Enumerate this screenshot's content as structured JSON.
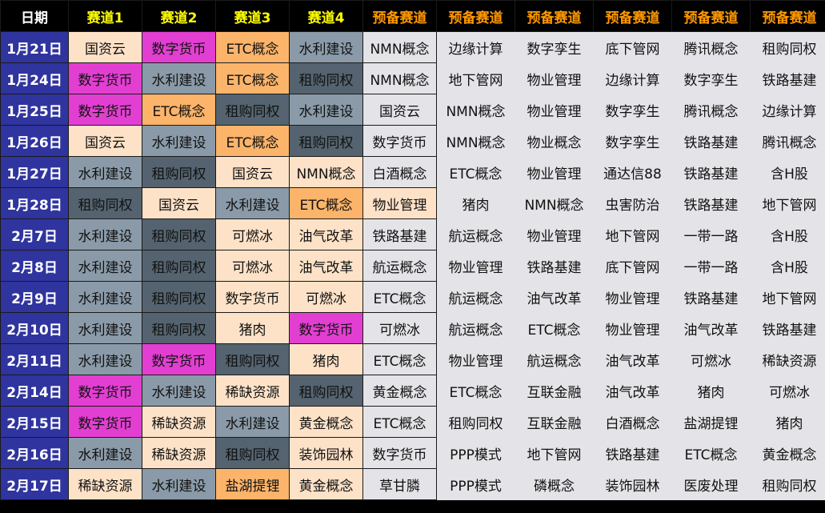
{
  "headers": [
    "日期",
    "赛道1",
    "赛道2",
    "赛道3",
    "赛道4",
    "预备赛道",
    "预备赛道",
    "预备赛道",
    "预备赛道",
    "预备赛道",
    "预备赛道"
  ],
  "rows": [
    {
      "date": "1月21日",
      "cells": [
        "国资云",
        "数字货币",
        "ETC概念",
        "水利建设",
        "NMN概念",
        "边缘计算",
        "数字孪生",
        "底下管网",
        "腾讯概念",
        "租购同权"
      ]
    },
    {
      "date": "1月24日",
      "cells": [
        "数字货币",
        "水利建设",
        "ETC概念",
        "租购同权",
        "NMN概念",
        "地下管网",
        "物业管理",
        "边缘计算",
        "数字孪生",
        "铁路基建"
      ]
    },
    {
      "date": "1月25日",
      "cells": [
        "数字货币",
        "ETC概念",
        "租购同权",
        "水利建设",
        "国资云",
        "NMN概念",
        "物业管理",
        "数字孪生",
        "腾讯概念",
        "边缘计算"
      ]
    },
    {
      "date": "1月26日",
      "cells": [
        "国资云",
        "水利建设",
        "ETC概念",
        "租购同权",
        "数字货币",
        "NMN概念",
        "物业概念",
        "数字孪生",
        "铁路基建",
        "腾讯概念"
      ]
    },
    {
      "date": "1月27日",
      "cells": [
        "水利建设",
        "租购同权",
        "国资云",
        "NMN概念",
        "白酒概念",
        "ETC概念",
        "物业管理",
        "通达信88",
        "铁路基建",
        "含H股"
      ]
    },
    {
      "date": "1月28日",
      "cells": [
        "租购同权",
        "国资云",
        "水利建设",
        "ETC概念",
        "物业管理",
        "猪肉",
        "NMN概念",
        "虫害防治",
        "铁路基建",
        "地下管网"
      ]
    },
    {
      "date": "2月7日",
      "cells": [
        "水利建设",
        "租购同权",
        "可燃冰",
        "油气改革",
        "铁路基建",
        "航运概念",
        "物业管理",
        "地下管网",
        "一带一路",
        "含H股"
      ]
    },
    {
      "date": "2月8日",
      "cells": [
        "水利建设",
        "租购同权",
        "可燃冰",
        "油气改革",
        "航运概念",
        "物业管理",
        "铁路基建",
        "底下管网",
        "一带一路",
        "含H股"
      ]
    },
    {
      "date": "2月9日",
      "cells": [
        "水利建设",
        "租购同权",
        "数字货币",
        "可燃冰",
        "ETC概念",
        "航运概念",
        "油气改革",
        "物业管理",
        "铁路基建",
        "地下管网"
      ]
    },
    {
      "date": "2月10日",
      "cells": [
        "水利建设",
        "租购同权",
        "猪肉",
        "数字货币",
        "可燃冰",
        "航运概念",
        "ETC概念",
        "物业管理",
        "油气改革",
        "铁路基建"
      ]
    },
    {
      "date": "2月11日",
      "cells": [
        "水利建设",
        "数字货币",
        "租购同权",
        "猪肉",
        "ETC概念",
        "物业管理",
        "航运概念",
        "油气改革",
        "可燃冰",
        "稀缺资源"
      ]
    },
    {
      "date": "2月14日",
      "cells": [
        "数字货币",
        "水利建设",
        "稀缺资源",
        "租购同权",
        "黄金概念",
        "ETC概念",
        "互联金融",
        "油气改革",
        "猪肉",
        "可燃冰"
      ]
    },
    {
      "date": "2月15日",
      "cells": [
        "数字货币",
        "稀缺资源",
        "水利建设",
        "黄金概念",
        "ETC概念",
        "租购同权",
        "互联金融",
        "白酒概念",
        "盐湖提锂",
        "猪肉"
      ]
    },
    {
      "date": "2月16日",
      "cells": [
        "水利建设",
        "稀缺资源",
        "租购同权",
        "装饰园林",
        "数字货币",
        "PPP模式",
        "地下管网",
        "铁路基建",
        "ETC概念",
        "黄金概念"
      ]
    },
    {
      "date": "2月17日",
      "cells": [
        "稀缺资源",
        "水利建设",
        "盐湖提锂",
        "黄金概念",
        "草甘膦",
        "PPP模式",
        "磷概念",
        "装饰园林",
        "医废处理",
        "租购同权"
      ]
    }
  ],
  "colors": {
    "header_bg": "#000000",
    "date_bg": "#2f349e",
    "track_header": "#ffff00",
    "reserve_header": "#ff9900",
    "peach": "#fde2c8",
    "magenta": "#e23fd2",
    "orange": "#fbb46a",
    "slate": "#8a9aa8",
    "dark_slate": "#54636f",
    "light_gray": "#e4e4e8"
  }
}
